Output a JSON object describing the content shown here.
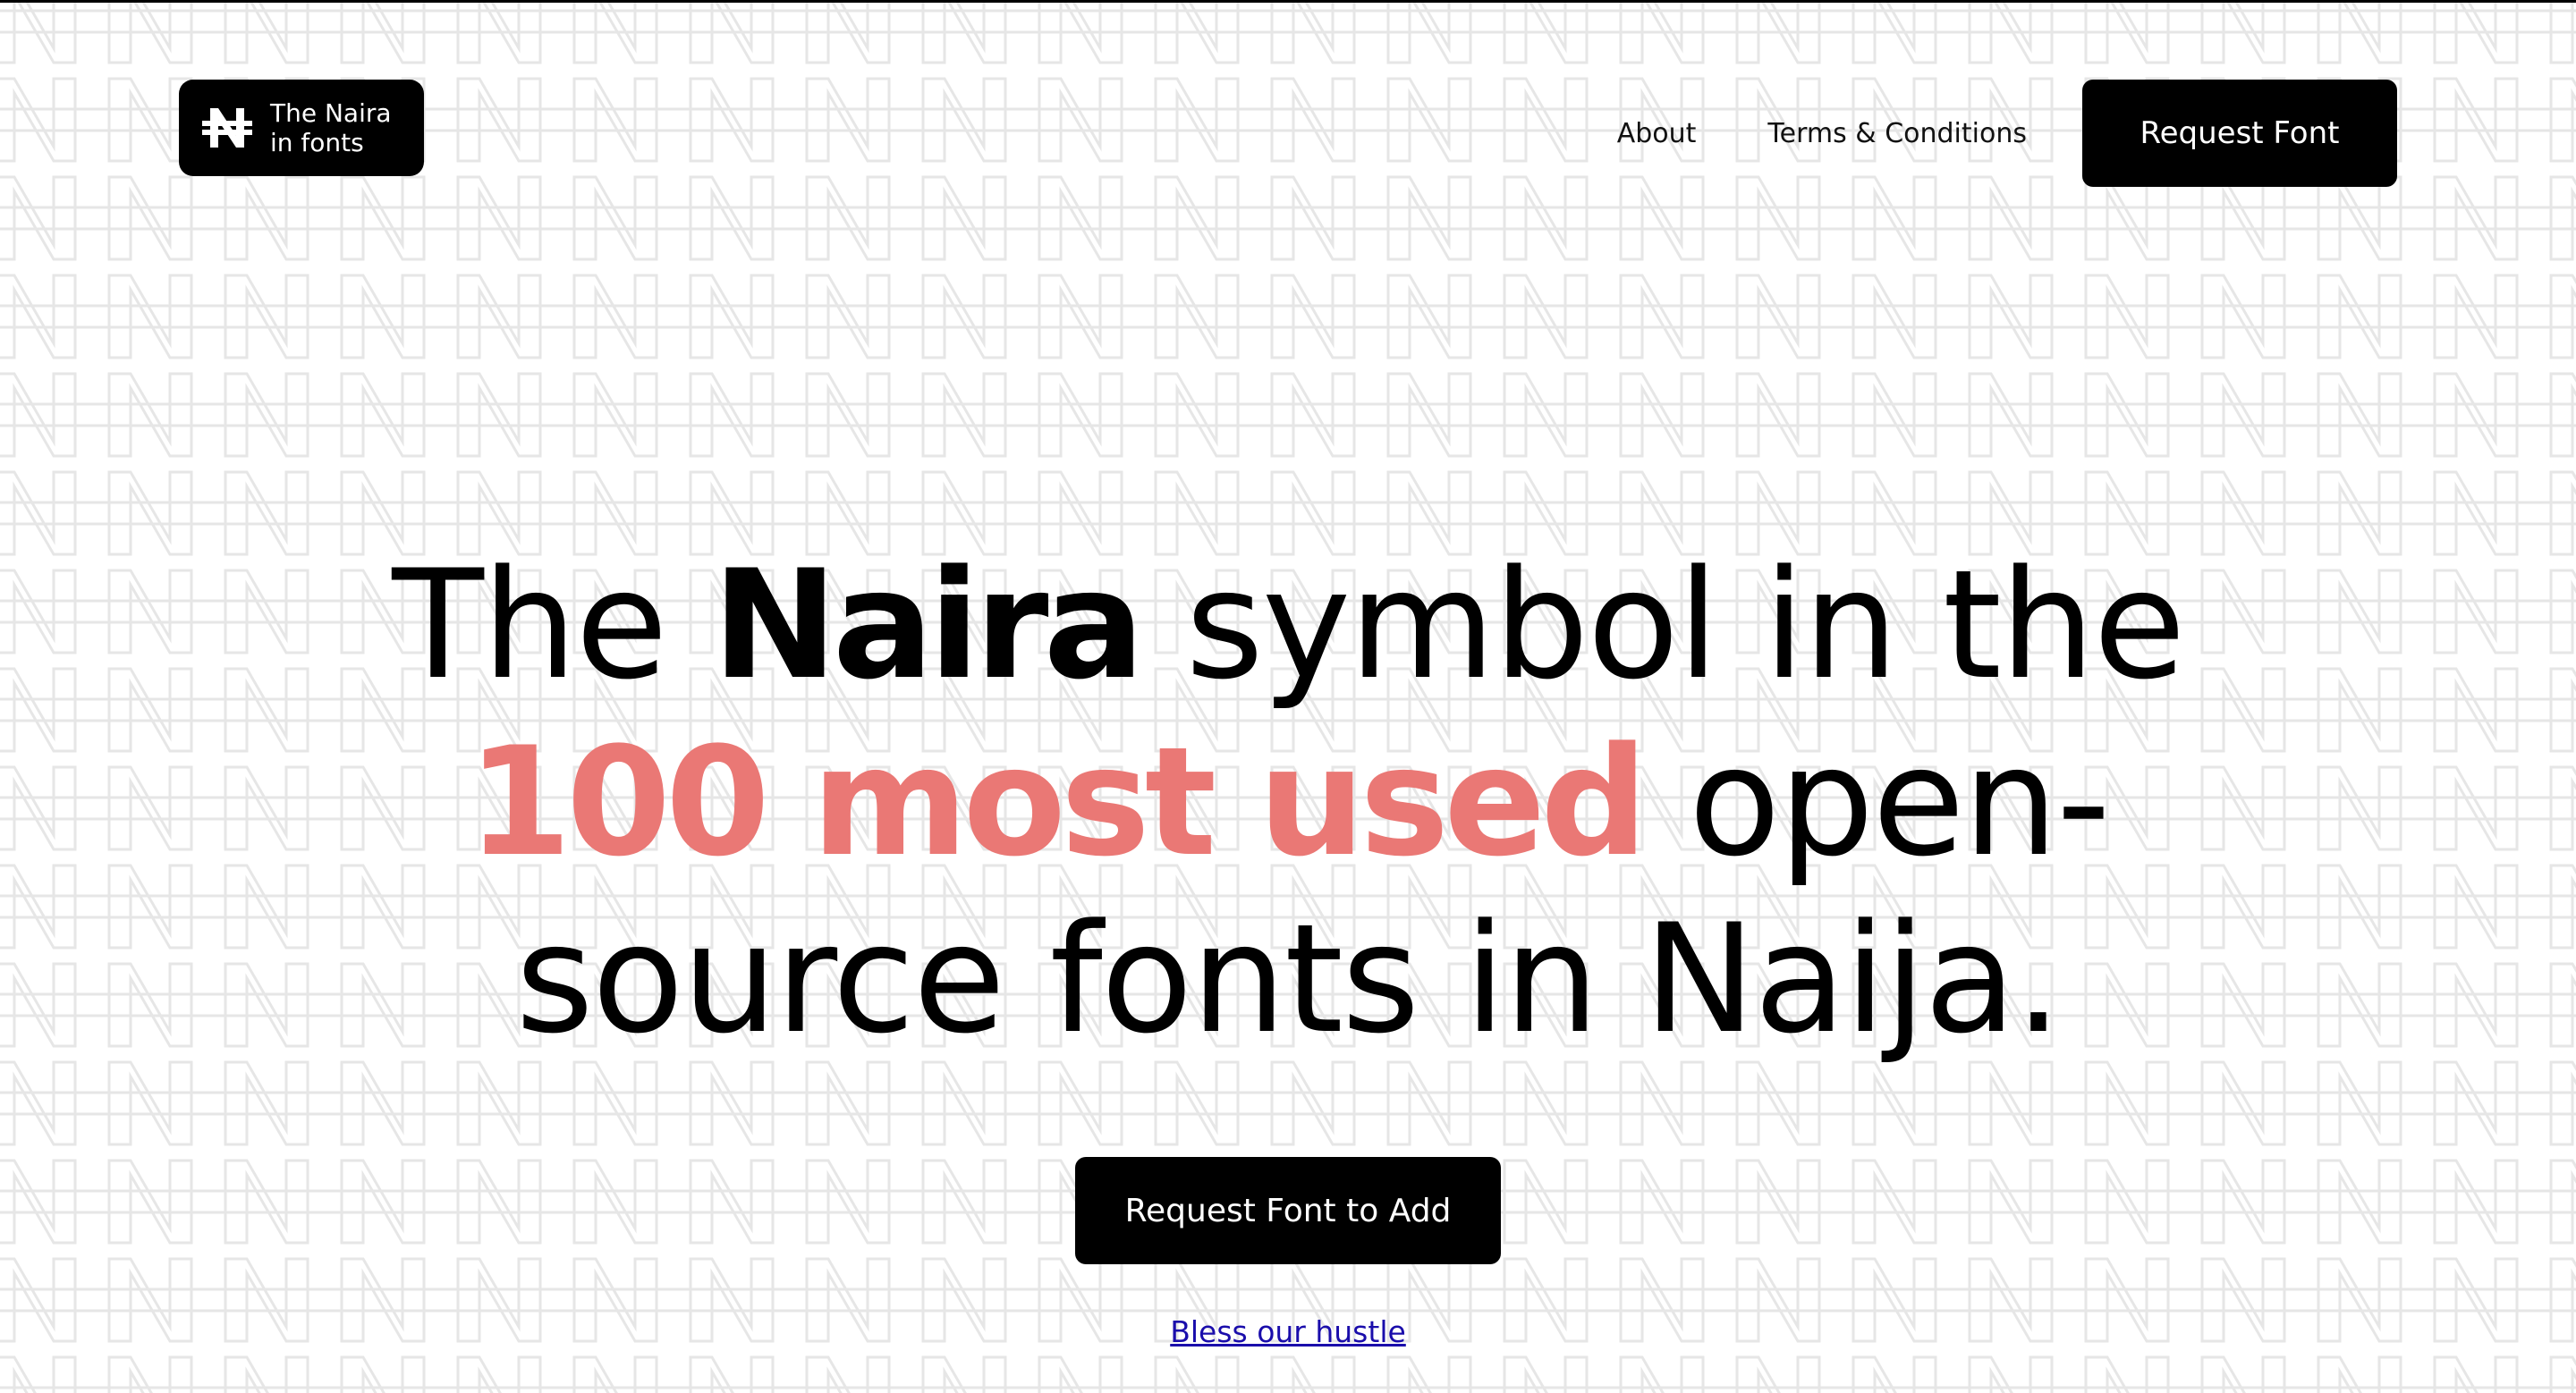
{
  "header": {
    "logo": {
      "icon": "naira-icon",
      "line1": "The Naira",
      "line2": "in fonts"
    },
    "nav": {
      "about": "About",
      "terms": "Terms & Conditions",
      "request_font": "Request Font"
    }
  },
  "hero": {
    "headline": {
      "l1_a": "The ",
      "l1_bold": "Naira",
      "l1_b": " symbol in the",
      "l2_accent": "100 most used",
      "l2_b": " open-",
      "l3": "source fonts in Naija."
    },
    "cta_label": "Request Font to Add",
    "bless_link": "Bless our hustle"
  },
  "colors": {
    "accent": "#ea7875",
    "primary": "#000000",
    "background": "#ffffff",
    "pattern": "#e6e6e6",
    "link": "#1a0dab"
  }
}
